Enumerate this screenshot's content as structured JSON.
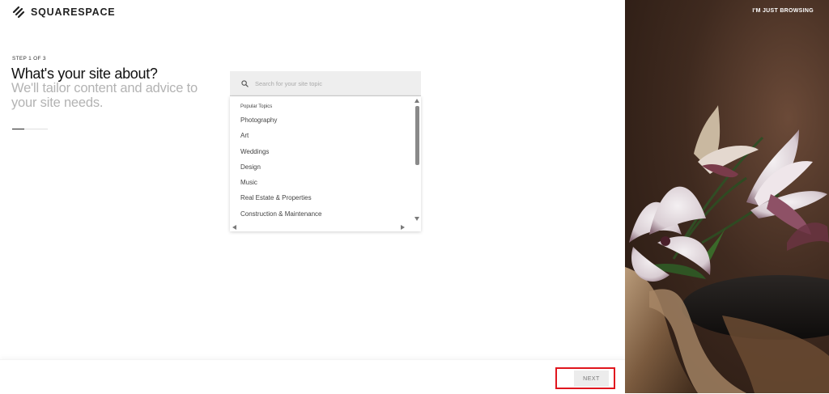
{
  "brand": {
    "name": "SQUARESPACE"
  },
  "header": {
    "browse_link": "I'M JUST BROWSING"
  },
  "step": {
    "label": "STEP 1 OF 3",
    "title": "What's your site about?",
    "subtitle": "We'll tailor content and advice to your site needs.",
    "progress_fraction": 0.33
  },
  "search": {
    "placeholder": "Search for your site topic",
    "value": ""
  },
  "topics": {
    "header": "Popular Topics",
    "items": [
      "Photography",
      "Art",
      "Weddings",
      "Design",
      "Music",
      "Real Estate & Properties",
      "Construction & Maintenance"
    ]
  },
  "footer": {
    "next_label": "NEXT"
  },
  "colors": {
    "highlight": "#e0161e",
    "subtitle_gray": "#b3b3b3",
    "search_bg": "#eeeeee",
    "photo_bg": "#3f2a1f"
  },
  "icons": {
    "logo": "squarespace-logo-icon",
    "search": "search-icon",
    "scroll_up": "chevron-up-icon",
    "scroll_down": "chevron-down-icon",
    "scroll_left": "chevron-left-icon",
    "scroll_right": "chevron-right-icon"
  }
}
